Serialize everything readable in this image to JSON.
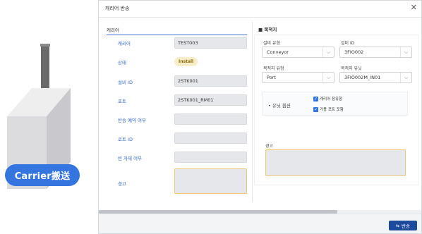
{
  "illustration": {
    "badge_label": "Carrier搬送",
    "colors": {
      "badge": "#3575e0",
      "box_light": "#eeeeef",
      "box_mid": "#dcdcdf",
      "box_dark": "#c9c9cd",
      "spike": "#6a6a6d"
    }
  },
  "dialog": {
    "title": "캐리어 반송",
    "close_glyph": "✕"
  },
  "left": {
    "section_title": "캐리어",
    "rows": [
      {
        "label": "캐리어",
        "value": "TEST003"
      },
      {
        "label": "상태",
        "badge": "Install"
      },
      {
        "label": "설비 ID",
        "value": "2STK001"
      },
      {
        "label": "포트",
        "value": "2STK001_RM01"
      },
      {
        "label": "반송 예약 여부",
        "value": ""
      },
      {
        "label": "로트 ID",
        "value": ""
      },
      {
        "label": "빈 자재 여부",
        "value": ""
      },
      {
        "label": "경고",
        "value": ""
      }
    ]
  },
  "right": {
    "section_title": "목적지",
    "fields": {
      "equipment_type": {
        "label": "설비 유형",
        "value": "Conveyor"
      },
      "equipment_id": {
        "label": "설비 ID",
        "value": "3FIO002"
      },
      "dest_type": {
        "label": "목적지 유형",
        "value": "Port"
      },
      "dest_name": {
        "label": "목적지 유닛",
        "value": "3FIO002M_IN01"
      }
    },
    "port_option": {
      "label": "• 유닛 옵션",
      "checks": [
        {
          "label": "캐리어 점유함",
          "checked": true
        },
        {
          "label": "가용 포트 포함",
          "checked": true
        }
      ]
    },
    "warning_label": "경고"
  },
  "footer": {
    "transfer_button": "반송"
  },
  "colors": {
    "accent": "#3566c8",
    "button": "#1e4a9e",
    "badge_bg": "#f8edc9",
    "warning_border": "#f1c976"
  }
}
